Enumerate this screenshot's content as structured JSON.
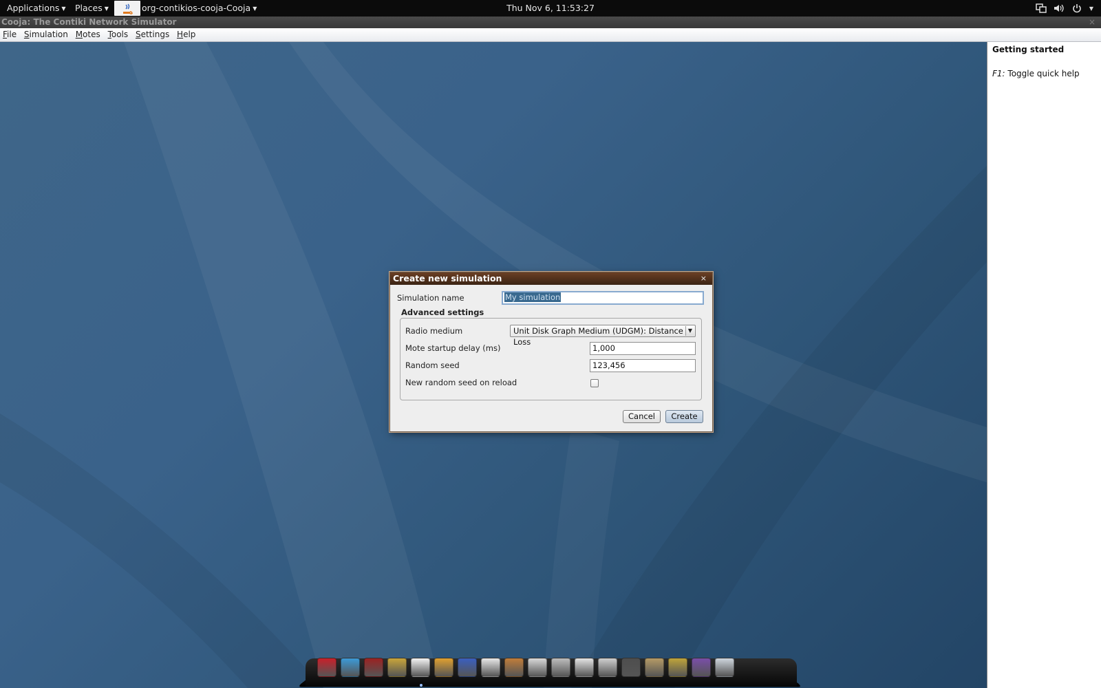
{
  "top_panel": {
    "applications_label": "Applications",
    "places_label": "Places",
    "window_label": "org-contikios-cooja-Cooja",
    "clock": "Thu Nov  6, 11:53:27",
    "tray_icons": [
      "network-icon",
      "volume-icon",
      "power-icon"
    ]
  },
  "window": {
    "title": "Cooja: The Contiki Network Simulator",
    "close_glyph": "×"
  },
  "menubar": {
    "items": [
      {
        "mnemonic": "F",
        "rest": "ile"
      },
      {
        "mnemonic": "S",
        "rest": "imulation"
      },
      {
        "mnemonic": "M",
        "rest": "otes"
      },
      {
        "mnemonic": "T",
        "rest": "ools"
      },
      {
        "mnemonic": "S",
        "rest": "ettings"
      },
      {
        "mnemonic": "H",
        "rest": "elp"
      }
    ]
  },
  "help_panel": {
    "title": "Getting started",
    "hint_key": "F1:",
    "hint_text": " Toggle quick help"
  },
  "dialog": {
    "title": "Create new simulation",
    "close_glyph": "×",
    "simulation_name_label": "Simulation name",
    "simulation_name_value": "My simulation",
    "advanced_title": "Advanced settings",
    "radio_medium_label": "Radio medium",
    "radio_medium_value": "Unit Disk Graph Medium (UDGM): Distance Loss",
    "mote_delay_label": "Mote startup delay (ms)",
    "mote_delay_value": "1,000",
    "random_seed_label": "Random seed",
    "random_seed_value": "123,456",
    "new_seed_label": "New random seed on reload",
    "new_seed_checked": false,
    "cancel_label": "Cancel",
    "create_label": "Create"
  },
  "dock": {
    "icons": [
      {
        "name": "accessibility-icon",
        "color": "#c8202a"
      },
      {
        "name": "blue-bird-icon",
        "color": "#3b9ad8"
      },
      {
        "name": "screenshot-icon",
        "color": "#9a2222"
      },
      {
        "name": "magnifier-icon",
        "color": "#c9a53a"
      },
      {
        "name": "java-icon",
        "color": "#f3f3f3",
        "running": true
      },
      {
        "name": "cat-face-icon",
        "color": "#e0a030"
      },
      {
        "name": "wizard-icon",
        "color": "#3a5fbf"
      },
      {
        "name": "chat-bubble-icon",
        "color": "#e8e8e8"
      },
      {
        "name": "scroll-icon",
        "color": "#c07d3a"
      },
      {
        "name": "document-icon",
        "color": "#d9d9d9"
      },
      {
        "name": "calculator-icon",
        "color": "#bdbdbd"
      },
      {
        "name": "text-editor-icon",
        "color": "#e4e4e4"
      },
      {
        "name": "search-icon",
        "color": "#cfcfcf"
      },
      {
        "name": "keyboard-layout-icon",
        "color": "#4e4e4e"
      },
      {
        "name": "archive-icon",
        "color": "#b59a66"
      },
      {
        "name": "gimp-icon",
        "color": "#bfa43a"
      },
      {
        "name": "workspace-icon",
        "color": "#7a4ea8"
      },
      {
        "name": "show-desktop-icon",
        "color": "#cfd6de"
      }
    ]
  }
}
